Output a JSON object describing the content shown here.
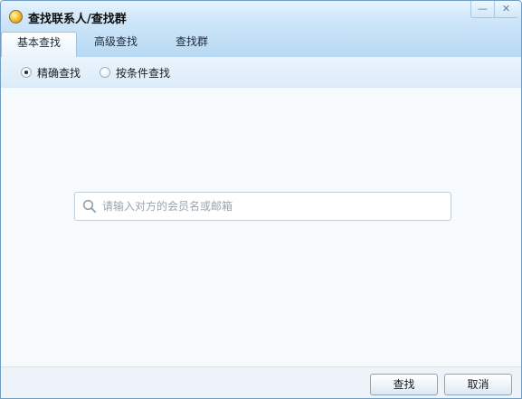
{
  "window": {
    "title": "查找联系人/查找群",
    "minimize_glyph": "—",
    "close_glyph": "✕"
  },
  "tabs": [
    {
      "label": "基本查找",
      "active": true
    },
    {
      "label": "高级查找",
      "active": false
    },
    {
      "label": "查找群",
      "active": false
    }
  ],
  "search_mode": {
    "options": [
      {
        "label": "精确查找",
        "selected": true
      },
      {
        "label": "按条件查找",
        "selected": false
      }
    ]
  },
  "search": {
    "placeholder": "请输入对方的会员名或邮箱",
    "value": "",
    "icon": "search-icon"
  },
  "footer": {
    "search_label": "查找",
    "cancel_label": "取消"
  },
  "colors": {
    "accent": "#b7d9f4",
    "border": "#6f9dc4",
    "content_bg": "#f6fafd"
  }
}
